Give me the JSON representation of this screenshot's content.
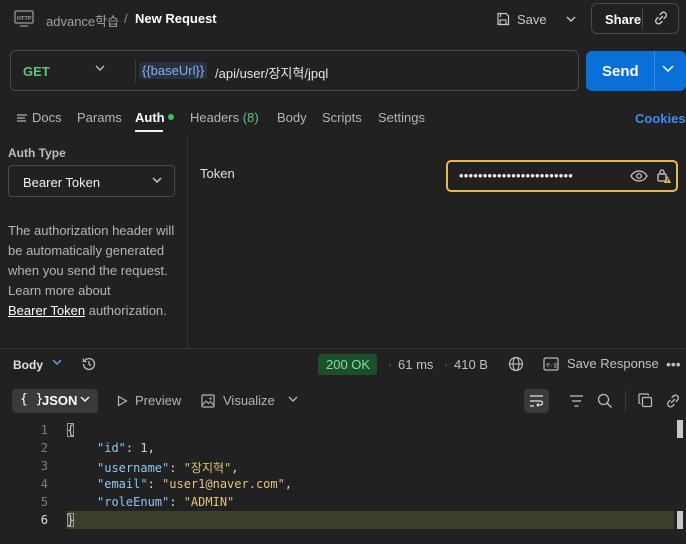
{
  "header": {
    "app_icon": "http-icon",
    "collection": "advance학습",
    "separator": "/",
    "request_title": "New Request",
    "save_label": "Save",
    "share_label": "Share"
  },
  "request": {
    "method": "GET",
    "url_variable": "{{baseUrl}}",
    "url_path": "/api/user/장지혁/jpql",
    "send_label": "Send"
  },
  "tabs": {
    "docs": "Docs",
    "params": "Params",
    "auth": "Auth",
    "headers": "Headers",
    "headers_count": "(8)",
    "body": "Body",
    "scripts": "Scripts",
    "settings": "Settings",
    "cookies": "Cookies",
    "active": "Auth"
  },
  "auth": {
    "type_label": "Auth Type",
    "type_value": "Bearer Token",
    "description": "The authorization header will be automatically generated when you send the request. Learn more about",
    "link_text": "Bearer Token",
    "description_suffix": "authorization.",
    "token_label": "Token",
    "token_masked": "••••••••••••••••••••••••"
  },
  "response": {
    "section_label": "Body",
    "status": "200 OK",
    "time": "61 ms",
    "size": "410 B",
    "save_response_label": "Save Response",
    "format": "JSON",
    "format_brace": "{ }",
    "preview_label": "Preview",
    "visualize_label": "Visualize",
    "colors": {
      "status_bg": "#1e4f2d",
      "status_text": "#7fe39a",
      "send_button": "#0a6fd6",
      "token_focus_border": "#e8b84a"
    }
  },
  "code": {
    "line_numbers": [
      "1",
      "2",
      "3",
      "4",
      "5",
      "6"
    ],
    "open_brace": "{",
    "close_brace": "}",
    "fields": [
      {
        "key": "\"id\"",
        "value": "1",
        "type": "number"
      },
      {
        "key": "\"username\"",
        "value": "\"장지혁\"",
        "type": "string"
      },
      {
        "key": "\"email\"",
        "value": "\"user1@naver.com\"",
        "type": "string"
      },
      {
        "key": "\"roleEnum\"",
        "value": "\"ADMIN\"",
        "type": "string"
      }
    ]
  }
}
